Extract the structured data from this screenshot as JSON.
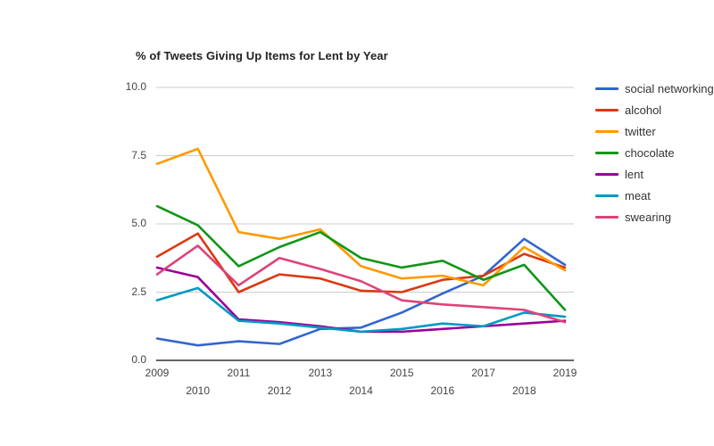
{
  "chart_data": {
    "type": "line",
    "title": "% of Tweets Giving Up Items for Lent by Year",
    "xlabel": "",
    "ylabel": "",
    "ylim": [
      0.0,
      10.0
    ],
    "y_ticks": [
      "0.0",
      "2.5",
      "5.0",
      "7.5",
      "10.0"
    ],
    "y_tick_values": [
      0.0,
      2.5,
      5.0,
      7.5,
      10.0
    ],
    "grid": true,
    "legend_position": "right",
    "categories": [
      "2009",
      "2010",
      "2011",
      "2012",
      "2013",
      "2014",
      "2015",
      "2016",
      "2017",
      "2018",
      "2019"
    ],
    "x": [
      2009,
      2010,
      2011,
      2012,
      2013,
      2014,
      2015,
      2016,
      2017,
      2018,
      2019
    ],
    "series": [
      {
        "name": "social networking",
        "color": "#3366cc",
        "values": [
          0.8,
          0.55,
          0.7,
          0.6,
          1.15,
          1.2,
          1.75,
          2.45,
          3.1,
          4.45,
          3.5
        ]
      },
      {
        "name": "alcohol",
        "color": "#dc3912",
        "values": [
          3.8,
          4.65,
          2.5,
          3.15,
          3.0,
          2.55,
          2.5,
          2.95,
          3.1,
          3.9,
          3.4
        ]
      },
      {
        "name": "twitter",
        "color": "#ff9900",
        "values": [
          7.2,
          7.75,
          4.7,
          4.45,
          4.8,
          3.45,
          3.0,
          3.1,
          2.75,
          4.15,
          3.3
        ]
      },
      {
        "name": "chocolate",
        "color": "#109618",
        "values": [
          5.65,
          4.95,
          3.45,
          4.15,
          4.7,
          3.75,
          3.4,
          3.65,
          2.95,
          3.5,
          1.85
        ]
      },
      {
        "name": "lent",
        "color": "#990099",
        "values": [
          3.4,
          3.05,
          1.5,
          1.4,
          1.25,
          1.05,
          1.05,
          1.15,
          1.25,
          1.35,
          1.45
        ]
      },
      {
        "name": "meat",
        "color": "#0099c6",
        "values": [
          2.2,
          2.65,
          1.45,
          1.35,
          1.2,
          1.05,
          1.15,
          1.35,
          1.25,
          1.75,
          1.6
        ]
      },
      {
        "name": "swearing",
        "color": "#dd4477",
        "values": [
          3.15,
          4.2,
          2.75,
          3.75,
          3.35,
          2.9,
          2.2,
          2.05,
          1.95,
          1.85,
          1.4
        ]
      }
    ]
  },
  "legend": {
    "items": [
      {
        "label": "social networking",
        "color": "#3366cc"
      },
      {
        "label": "alcohol",
        "color": "#dc3912"
      },
      {
        "label": "twitter",
        "color": "#ff9900"
      },
      {
        "label": "chocolate",
        "color": "#109618"
      },
      {
        "label": "lent",
        "color": "#990099"
      },
      {
        "label": "meat",
        "color": "#0099c6"
      },
      {
        "label": "swearing",
        "color": "#dd4477"
      }
    ]
  },
  "axes": {
    "gridline_color": "#cccccc",
    "baseline_color": "#333333",
    "tick_text_color": "#444444"
  }
}
